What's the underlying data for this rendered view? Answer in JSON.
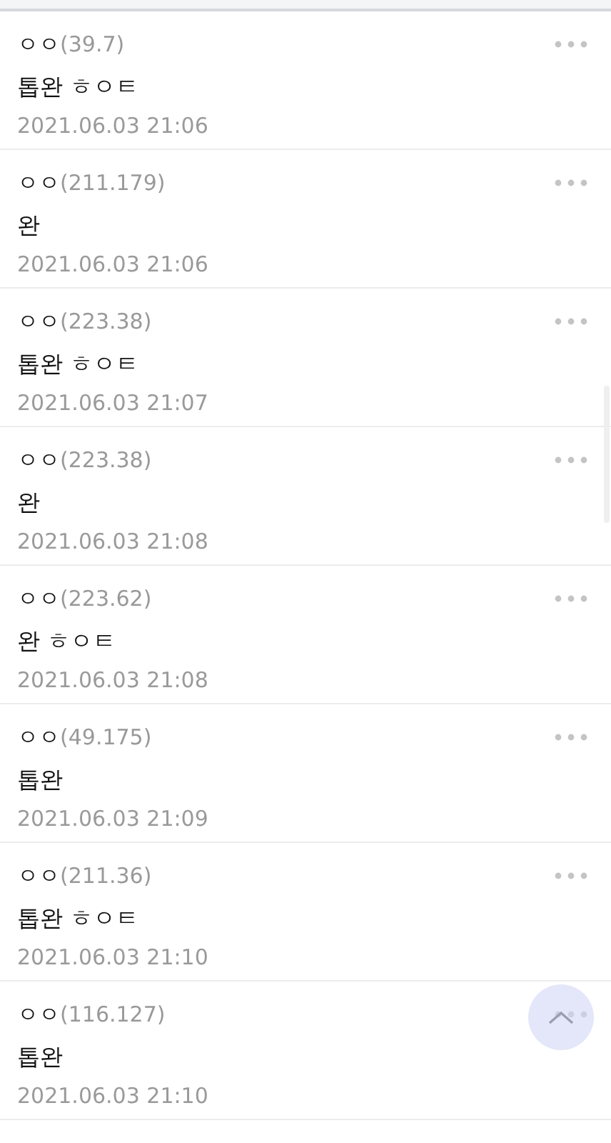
{
  "comments": [
    {
      "author": "ㅇㅇ",
      "ip": "(39.7)",
      "body": "톱완 ㅎㅇㅌ",
      "date": "2021.06.03 21:06"
    },
    {
      "author": "ㅇㅇ",
      "ip": "(211.179)",
      "body": "완",
      "date": "2021.06.03 21:06"
    },
    {
      "author": "ㅇㅇ",
      "ip": "(223.38)",
      "body": "톱완 ㅎㅇㅌ",
      "date": "2021.06.03 21:07"
    },
    {
      "author": "ㅇㅇ",
      "ip": "(223.38)",
      "body": "완",
      "date": "2021.06.03 21:08"
    },
    {
      "author": "ㅇㅇ",
      "ip": "(223.62)",
      "body": "완 ㅎㅇㅌ",
      "date": "2021.06.03 21:08"
    },
    {
      "author": "ㅇㅇ",
      "ip": "(49.175)",
      "body": "톱완",
      "date": "2021.06.03 21:09"
    },
    {
      "author": "ㅇㅇ",
      "ip": "(211.36)",
      "body": "톱완 ㅎㅇㅌ",
      "date": "2021.06.03 21:10"
    },
    {
      "author": "ㅇㅇ",
      "ip": "(116.127)",
      "body": "톱완",
      "date": "2021.06.03 21:10"
    }
  ]
}
